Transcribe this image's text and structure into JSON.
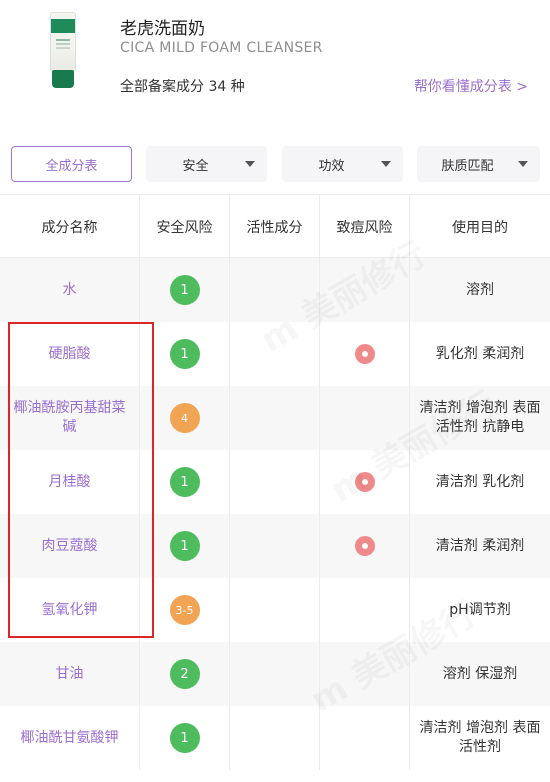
{
  "product": {
    "name": "老虎洗面奶",
    "subtitle": "CICA MILD FOAM CLEANSER",
    "ingredient_count": "全部备案成分 34 种",
    "help_link": "帮你看懂成分表 >"
  },
  "filters": [
    {
      "label": "全成分表",
      "active": true
    },
    {
      "label": "安全",
      "active": false
    },
    {
      "label": "功效",
      "active": false
    },
    {
      "label": "肤质匹配",
      "active": false
    }
  ],
  "columns": [
    "成分名称",
    "安全风险",
    "活性成分",
    "致痘风险",
    "使用目的"
  ],
  "rows": [
    {
      "name": "水",
      "safety": "1",
      "safety_color": "#4dbb5e",
      "active": "",
      "acne": false,
      "purpose": "溶剂"
    },
    {
      "name": "硬脂酸",
      "safety": "1",
      "safety_color": "#4dbb5e",
      "active": "",
      "acne": true,
      "purpose": "乳化剂 柔润剂"
    },
    {
      "name": "椰油酰胺丙基甜菜碱",
      "safety": "4",
      "safety_color": "#f0a454",
      "active": "",
      "acne": false,
      "purpose": "清洁剂 增泡剂 表面活性剂 抗静电"
    },
    {
      "name": "月桂酸",
      "safety": "1",
      "safety_color": "#4dbb5e",
      "active": "",
      "acne": true,
      "purpose": "清洁剂 乳化剂"
    },
    {
      "name": "肉豆蔻酸",
      "safety": "1",
      "safety_color": "#4dbb5e",
      "active": "",
      "acne": true,
      "purpose": "清洁剂 柔润剂"
    },
    {
      "name": "氢氧化钾",
      "safety": "3-5",
      "safety_color": "#f0a454",
      "active": "",
      "acne": false,
      "purpose": "pH调节剂"
    },
    {
      "name": "甘油",
      "safety": "2",
      "safety_color": "#4dbb5e",
      "active": "",
      "acne": false,
      "purpose": "溶剂 保湿剂"
    },
    {
      "name": "椰油酰甘氨酸钾",
      "safety": "1",
      "safety_color": "#4dbb5e",
      "active": "",
      "acne": false,
      "purpose": "清洁剂 增泡剂 表面活性剂"
    }
  ]
}
